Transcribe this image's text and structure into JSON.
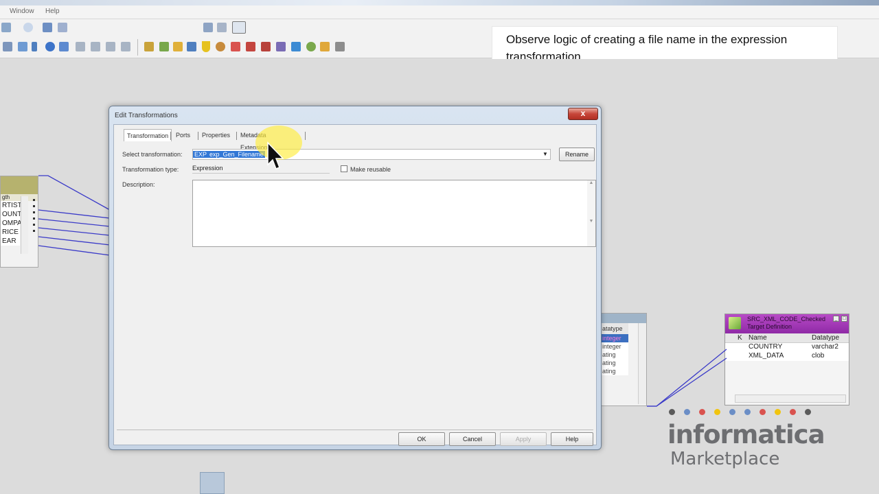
{
  "menubar": {
    "items": [
      "Window",
      "Help"
    ]
  },
  "toolbar": {
    "zoom_combo_value": ""
  },
  "notice": {
    "text": "Observe logic of creating a file name in the expression transformation."
  },
  "dialog": {
    "title": "Edit Transformations",
    "close_label": "x",
    "tabs": [
      {
        "label": "Transformation"
      },
      {
        "label": "Ports"
      },
      {
        "label": "Properties"
      },
      {
        "label": "Metadata Extensions"
      }
    ],
    "select_transformation_label": "Select transformation:",
    "select_transformation_prefix": "EXP",
    "select_transformation_value": "exp_Gen_Filename",
    "rename_label": "Rename",
    "transformation_type_label": "Transformation type:",
    "transformation_type_value": "Expression",
    "make_reusable_label": "Make reusable",
    "make_reusable_checked": false,
    "description_label": "Description:",
    "description_value": "",
    "buttons": {
      "ok": "OK",
      "cancel": "Cancel",
      "apply": "Apply",
      "help": "Help"
    }
  },
  "left_object": {
    "header_fragment": "gth",
    "rows": [
      "RTIST",
      "OUNTI",
      "OMPAI",
      "RICE",
      "EAR"
    ]
  },
  "mid_object": {
    "column_header": "atatype",
    "rows": [
      "integer",
      "integer",
      "ating",
      "ating",
      "ating"
    ]
  },
  "target_object": {
    "title_line1": "SRC_XML_CODE_Checked",
    "title_line2": "Target Definition",
    "columns": {
      "key": "K",
      "name": "Name",
      "datatype": "Datatype"
    },
    "rows": [
      {
        "name": "COUNTRY",
        "datatype": "varchar2"
      },
      {
        "name": "XML_DATA",
        "datatype": "clob"
      }
    ]
  },
  "logo": {
    "word": "informatica",
    "sub": "Marketplace",
    "dot_colors": [
      "#5b5b5b",
      "#6b8ec6",
      "#d9534f",
      "#f1c40f",
      "#6b8ec6",
      "#6b8ec6",
      "#d9534f",
      "#f1c40f",
      "#d9534f",
      "#5b5b5b"
    ]
  },
  "colors": {
    "target_header": "#a43ab8",
    "link": "#3a3ac8",
    "selection": "#3177d6"
  }
}
